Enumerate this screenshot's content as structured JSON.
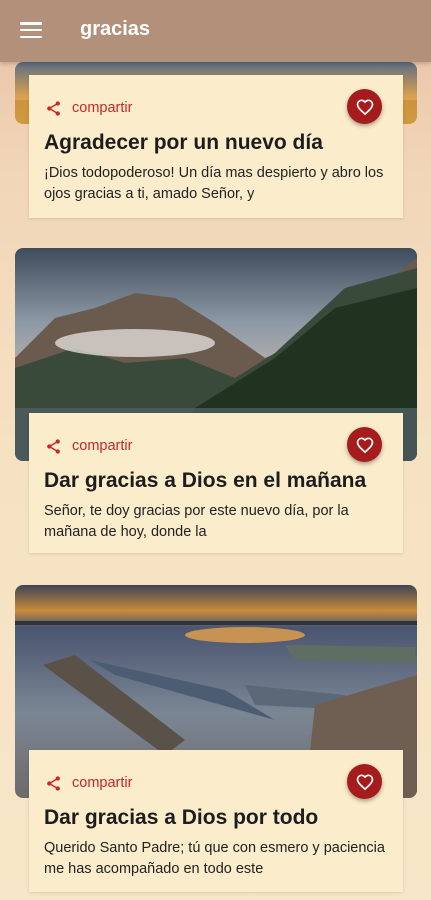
{
  "app_bar": {
    "title": "gracias",
    "menu_icon": "hamburger-menu-icon"
  },
  "cards": [
    {
      "share_label": "compartir",
      "title": "Agradecer por un nuevo día",
      "excerpt": "¡Dios todopoderoso! Un día mas despierto y abro los ojos gracias a ti, amado Señor, y",
      "image": "sunrise-landscape-image"
    },
    {
      "share_label": "compartir",
      "title": "Dar gracias a Dios en el mañana",
      "excerpt": "Señor, te doy gracias por este nuevo día, por la mañana de hoy, donde la",
      "image": "mountain-lake-image"
    },
    {
      "share_label": "compartir",
      "title": "Dar gracias a Dios por todo",
      "excerpt": "Querido Santo Padre; tú que con esmero y paciencia me has acompañado en todo este",
      "image": "boats-sunset-image"
    }
  ],
  "icons": {
    "share": "share-icon",
    "favorite": "heart-icon"
  },
  "colors": {
    "app_bar": "#b3907a",
    "accent": "#c62828",
    "favorite_button": "#a61c1c",
    "card": "#fbeccb"
  }
}
